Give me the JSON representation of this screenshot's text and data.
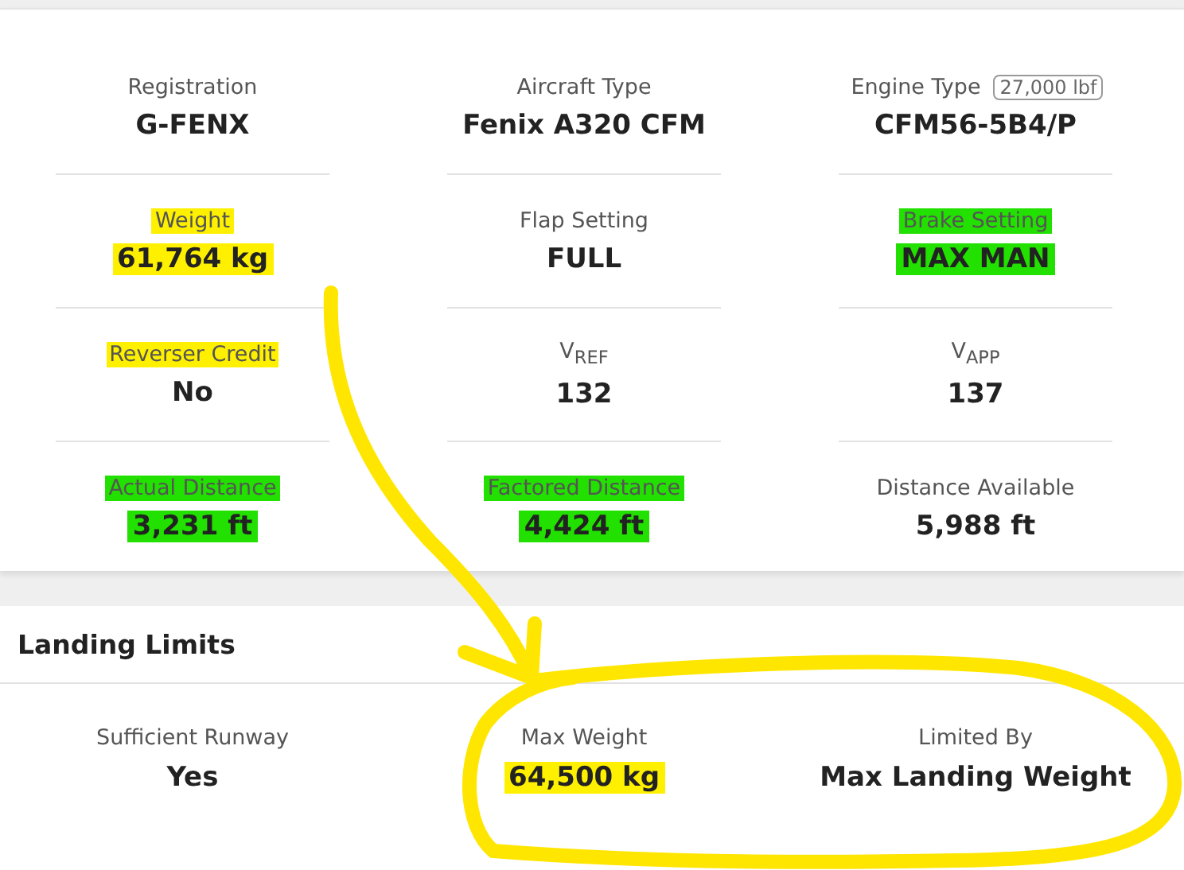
{
  "details": [
    {
      "label": {
        "text": "Registration"
      },
      "value": {
        "text": "G-FENX"
      }
    },
    {
      "label": {
        "text": "Aircraft Type"
      },
      "value": {
        "text": "Fenix A320 CFM"
      }
    },
    {
      "label": {
        "text": "Engine Type"
      },
      "badge": "27,000 lbf",
      "value": {
        "text": "CFM56-5B4/P"
      }
    },
    {
      "label": {
        "text": "Weight",
        "color": "#fff000"
      },
      "value": {
        "text": "61,764 kg",
        "color": "#fff000"
      }
    },
    {
      "label": {
        "text": "Flap Setting"
      },
      "value": {
        "text": "FULL"
      }
    },
    {
      "label": {
        "text": "Brake Setting",
        "color": "#22e000"
      },
      "value": {
        "text": "MAX MAN",
        "color": "#22e000"
      }
    },
    {
      "label": {
        "text": "Reverser Credit",
        "color": "#fff000"
      },
      "value": {
        "text": "No"
      }
    },
    {
      "label": {
        "text": "V$_{REF}$"
      },
      "value": {
        "text": "132"
      }
    },
    {
      "label": {
        "text": "V$_{APP}$"
      },
      "value": {
        "text": "137"
      }
    },
    {
      "label": {
        "text": "Actual Distance",
        "color": "#22e000"
      },
      "value": {
        "text": "3,231 ft",
        "color": "#22e000"
      }
    },
    {
      "label": {
        "text": "Factored Distance",
        "color": "#22e000"
      },
      "value": {
        "text": "4,424 ft",
        "color": "#22e000"
      }
    },
    {
      "label": {
        "text": "Distance Available"
      },
      "value": {
        "text": "5,988 ft"
      }
    }
  ],
  "landing_limits": {
    "title": "Landing Limits",
    "items": [
      {
        "label": {
          "text": "Sufficient Runway"
        },
        "value": {
          "text": "Yes"
        }
      },
      {
        "label": {
          "text": "Max Weight"
        },
        "value": {
          "text": "64,500 kg",
          "color": "#fff000"
        }
      },
      {
        "label": {
          "text": "Limited By"
        },
        "value": {
          "text": "Max Landing Weight"
        }
      }
    ]
  }
}
